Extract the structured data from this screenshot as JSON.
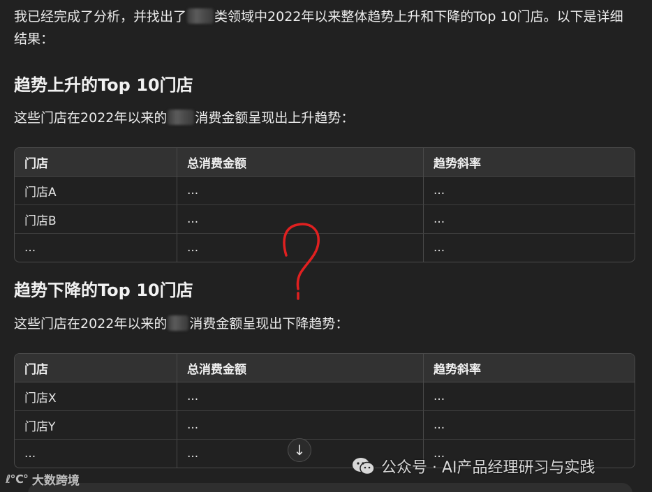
{
  "intro": {
    "part1": "我已经完成了分析，并找出了",
    "part2": "类领域中2022年以来整体趋势上升和下降的Top 10门店。以下是详细结果："
  },
  "up_section": {
    "heading": "趋势上升的Top 10门店",
    "desc_part1": "这些门店在2022年以来的",
    "desc_part2": "消费金额呈现出上升趋势：",
    "table": {
      "headers": [
        "门店",
        "总消费金额",
        "趋势斜率"
      ],
      "rows": [
        [
          "门店A",
          "...",
          "..."
        ],
        [
          "门店B",
          "...",
          "..."
        ],
        [
          "...",
          "...",
          "..."
        ]
      ]
    }
  },
  "down_section": {
    "heading": "趋势下降的Top 10门店",
    "desc_part1": "这些门店在2022年以来的",
    "desc_part2": "消费金额呈现出下降趋势：",
    "table": {
      "headers": [
        "门店",
        "总消费金额",
        "趋势斜率"
      ],
      "rows": [
        [
          "门店X",
          "...",
          "..."
        ],
        [
          "门店Y",
          "...",
          "..."
        ],
        [
          "...",
          "...",
          "..."
        ]
      ]
    }
  },
  "scroll_button": {
    "icon": "arrow-down-icon",
    "glyph": "↓"
  },
  "watermark": {
    "text": "公众号 · AI产品经理研习与实践",
    "icon": "wechat-icon"
  },
  "corner_logo": {
    "mark": "ℓ℃°",
    "text": "大数跨境"
  },
  "colors": {
    "background": "#212121",
    "text": "#ececec",
    "table_header": "#323232",
    "border": "#4a4a4a",
    "annotation": "#e02020"
  }
}
